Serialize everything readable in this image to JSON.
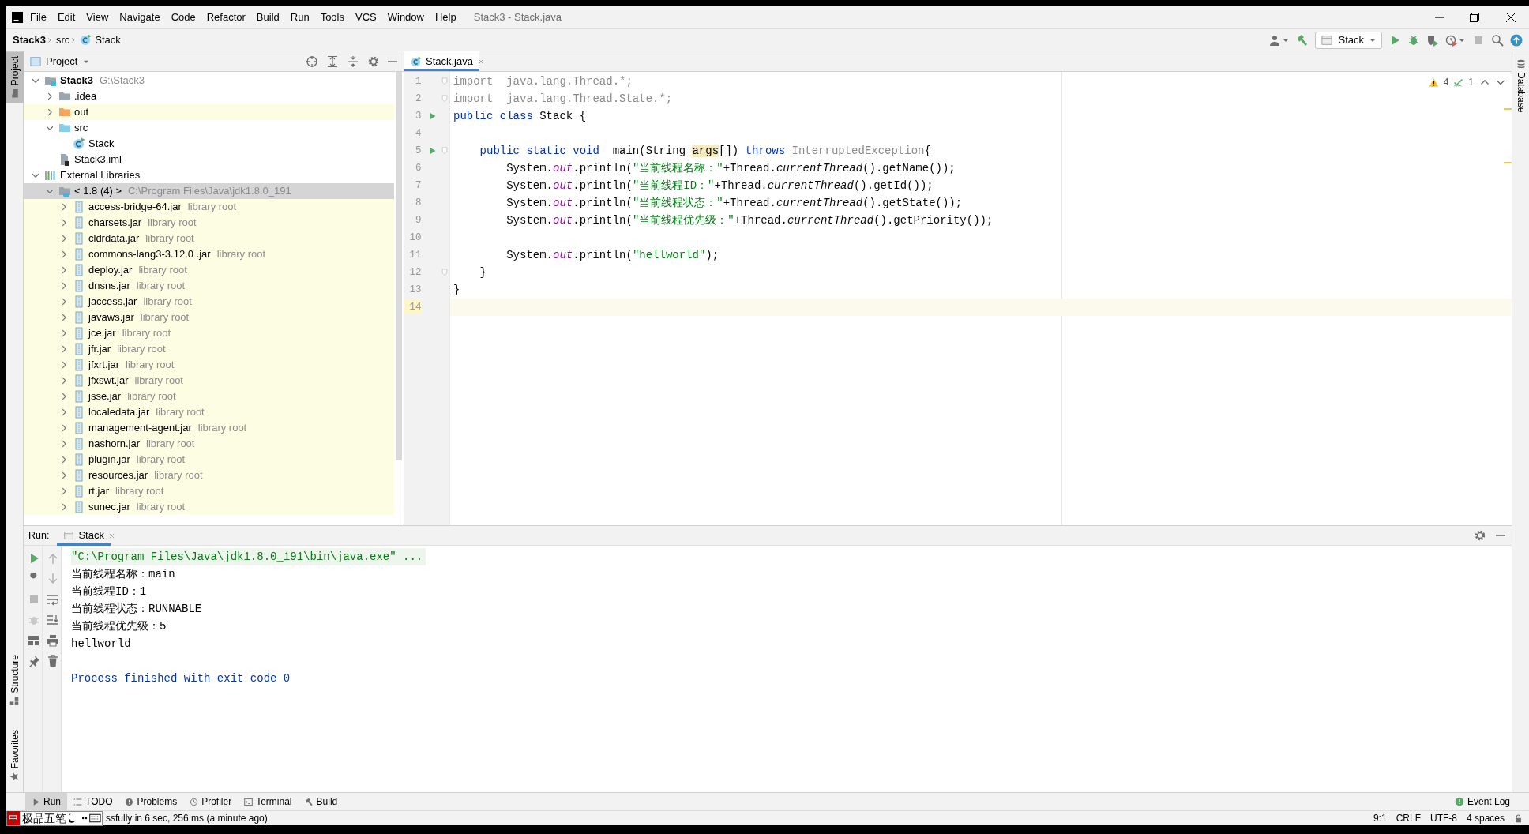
{
  "window": {
    "title": "Stack3 - Stack.java"
  },
  "menu": [
    "File",
    "Edit",
    "View",
    "Navigate",
    "Code",
    "Refactor",
    "Build",
    "Run",
    "Tools",
    "VCS",
    "Window",
    "Help"
  ],
  "breadcrumb": [
    {
      "label": "Stack3",
      "kind": "project"
    },
    {
      "label": "src",
      "kind": "folder"
    },
    {
      "label": "Stack",
      "kind": "class"
    }
  ],
  "toolbar": {
    "run_config": "Stack"
  },
  "left_stripe": {
    "top": [
      {
        "label": "Project",
        "selected": true
      }
    ],
    "bottom": [
      {
        "label": "Structure",
        "selected": false
      },
      {
        "label": "Favorites",
        "selected": false
      }
    ]
  },
  "project_panel": {
    "title": "Project",
    "tree": [
      {
        "label": "Stack3",
        "hint": "G:\\Stack3",
        "kind": "module",
        "expanded": true,
        "selected": false,
        "highlighted": false,
        "children": [
          {
            "label": ".idea",
            "kind": "folder-grey",
            "expanded": false,
            "selected": false,
            "highlighted": false
          },
          {
            "label": "out",
            "kind": "folder-orange",
            "expanded": false,
            "selected": false,
            "highlighted": true
          },
          {
            "label": "src",
            "kind": "folder-blue",
            "expanded": true,
            "selected": false,
            "highlighted": false,
            "children": [
              {
                "label": "Stack",
                "kind": "class",
                "selected": false,
                "highlighted": false
              }
            ]
          },
          {
            "label": "Stack3.iml",
            "kind": "iml",
            "selected": false,
            "highlighted": false
          }
        ]
      },
      {
        "label": "External Libraries",
        "kind": "libraries",
        "expanded": true,
        "selected": false,
        "highlighted": false,
        "children": [
          {
            "label": "< 1.8 (4) >",
            "hint": "C:\\Program Files\\Java\\jdk1.8.0_191",
            "kind": "jdk",
            "expanded": true,
            "selected": true,
            "highlighted": false,
            "children": [
              {
                "label": "access-bridge-64.jar",
                "hint": "library root",
                "kind": "jar",
                "expanded": false,
                "selected": false,
                "highlighted": true
              },
              {
                "label": "charsets.jar",
                "hint": "library root",
                "kind": "jar",
                "expanded": false,
                "selected": false,
                "highlighted": true
              },
              {
                "label": "cldrdata.jar",
                "hint": "library root",
                "kind": "jar",
                "expanded": false,
                "selected": false,
                "highlighted": true
              },
              {
                "label": "commons-lang3-3.12.0 .jar",
                "hint": "library root",
                "kind": "jar",
                "expanded": false,
                "selected": false,
                "highlighted": true
              },
              {
                "label": "deploy.jar",
                "hint": "library root",
                "kind": "jar",
                "expanded": false,
                "selected": false,
                "highlighted": true
              },
              {
                "label": "dnsns.jar",
                "hint": "library root",
                "kind": "jar",
                "expanded": false,
                "selected": false,
                "highlighted": true
              },
              {
                "label": "jaccess.jar",
                "hint": "library root",
                "kind": "jar",
                "expanded": false,
                "selected": false,
                "highlighted": true
              },
              {
                "label": "javaws.jar",
                "hint": "library root",
                "kind": "jar",
                "expanded": false,
                "selected": false,
                "highlighted": true
              },
              {
                "label": "jce.jar",
                "hint": "library root",
                "kind": "jar",
                "expanded": false,
                "selected": false,
                "highlighted": true
              },
              {
                "label": "jfr.jar",
                "hint": "library root",
                "kind": "jar",
                "expanded": false,
                "selected": false,
                "highlighted": true
              },
              {
                "label": "jfxrt.jar",
                "hint": "library root",
                "kind": "jar",
                "expanded": false,
                "selected": false,
                "highlighted": true
              },
              {
                "label": "jfxswt.jar",
                "hint": "library root",
                "kind": "jar",
                "expanded": false,
                "selected": false,
                "highlighted": true
              },
              {
                "label": "jsse.jar",
                "hint": "library root",
                "kind": "jar",
                "expanded": false,
                "selected": false,
                "highlighted": true
              },
              {
                "label": "localedata.jar",
                "hint": "library root",
                "kind": "jar",
                "expanded": false,
                "selected": false,
                "highlighted": true
              },
              {
                "label": "management-agent.jar",
                "hint": "library root",
                "kind": "jar",
                "expanded": false,
                "selected": false,
                "highlighted": true
              },
              {
                "label": "nashorn.jar",
                "hint": "library root",
                "kind": "jar",
                "expanded": false,
                "selected": false,
                "highlighted": true
              },
              {
                "label": "plugin.jar",
                "hint": "library root",
                "kind": "jar",
                "expanded": false,
                "selected": false,
                "highlighted": true
              },
              {
                "label": "resources.jar",
                "hint": "library root",
                "kind": "jar",
                "expanded": false,
                "selected": false,
                "highlighted": true
              },
              {
                "label": "rt.jar",
                "hint": "library root",
                "kind": "jar",
                "expanded": false,
                "selected": false,
                "highlighted": true
              },
              {
                "label": "sunec.jar",
                "hint": "library root",
                "kind": "jar",
                "expanded": false,
                "selected": false,
                "highlighted": true
              }
            ]
          }
        ]
      }
    ]
  },
  "editor": {
    "tabs": [
      {
        "label": "Stack.java",
        "selected": true
      }
    ],
    "inspections": {
      "warnings": "4",
      "weak_warnings": "1"
    },
    "lines": [
      {
        "number": "1",
        "run_marker": false,
        "fold_marker": true,
        "current": false,
        "tokens": [
          {
            "text": "import  java.lang.Thread.*;",
            "kind": "unused"
          }
        ]
      },
      {
        "number": "2",
        "run_marker": false,
        "fold_marker": true,
        "current": false,
        "tokens": [
          {
            "text": "import  java.lang.Thread.State.*;",
            "kind": "unused"
          }
        ]
      },
      {
        "number": "3",
        "run_marker": true,
        "fold_marker": false,
        "current": false,
        "tokens": [
          {
            "text": "public class ",
            "kind": "keyword"
          },
          {
            "text": "Stack {",
            "kind": "plain"
          }
        ]
      },
      {
        "number": "4",
        "run_marker": false,
        "fold_marker": false,
        "current": false
      },
      {
        "number": "5",
        "run_marker": true,
        "fold_marker": true,
        "current": false,
        "tokens": [
          {
            "text": "    public static void ",
            "kind": "keyword"
          },
          {
            "text": " main(String ",
            "kind": "plain"
          },
          {
            "text": "args",
            "kind": "highlight"
          },
          {
            "text": "[]) ",
            "kind": "plain"
          },
          {
            "text": "throws",
            "kind": "keyword"
          },
          {
            "text": " InterruptedException",
            "kind": "unused"
          },
          {
            "text": "{",
            "kind": "plain"
          }
        ]
      },
      {
        "number": "6",
        "run_marker": false,
        "fold_marker": false,
        "current": false,
        "tokens": [
          {
            "text": "        System.",
            "kind": "plain"
          },
          {
            "text": "out",
            "kind": "field"
          },
          {
            "text": ".println(",
            "kind": "plain"
          },
          {
            "text": "\"当前线程名称：\"",
            "kind": "string"
          },
          {
            "text": "+Thread.",
            "kind": "plain"
          },
          {
            "text": "currentThread",
            "kind": "static"
          },
          {
            "text": "().getName());",
            "kind": "plain"
          }
        ]
      },
      {
        "number": "7",
        "run_marker": false,
        "fold_marker": false,
        "current": false,
        "tokens": [
          {
            "text": "        System.",
            "kind": "plain"
          },
          {
            "text": "out",
            "kind": "field"
          },
          {
            "text": ".println(",
            "kind": "plain"
          },
          {
            "text": "\"当前线程ID：\"",
            "kind": "string"
          },
          {
            "text": "+Thread.",
            "kind": "plain"
          },
          {
            "text": "currentThread",
            "kind": "static"
          },
          {
            "text": "().getId());",
            "kind": "plain"
          }
        ]
      },
      {
        "number": "8",
        "run_marker": false,
        "fold_marker": false,
        "current": false,
        "tokens": [
          {
            "text": "        System.",
            "kind": "plain"
          },
          {
            "text": "out",
            "kind": "field"
          },
          {
            "text": ".println(",
            "kind": "plain"
          },
          {
            "text": "\"当前线程状态：\"",
            "kind": "string"
          },
          {
            "text": "+Thread.",
            "kind": "plain"
          },
          {
            "text": "currentThread",
            "kind": "static"
          },
          {
            "text": "().getState());",
            "kind": "plain"
          }
        ]
      },
      {
        "number": "9",
        "run_marker": false,
        "fold_marker": false,
        "current": false,
        "tokens": [
          {
            "text": "        System.",
            "kind": "plain"
          },
          {
            "text": "out",
            "kind": "field"
          },
          {
            "text": ".println(",
            "kind": "plain"
          },
          {
            "text": "\"当前线程优先级：\"",
            "kind": "string"
          },
          {
            "text": "+Thread.",
            "kind": "plain"
          },
          {
            "text": "currentThread",
            "kind": "static"
          },
          {
            "text": "().getPriority());",
            "kind": "plain"
          }
        ]
      },
      {
        "number": "10",
        "run_marker": false,
        "fold_marker": false,
        "current": false
      },
      {
        "number": "11",
        "run_marker": false,
        "fold_marker": false,
        "current": false,
        "tokens": [
          {
            "text": "        System.",
            "kind": "plain"
          },
          {
            "text": "out",
            "kind": "field"
          },
          {
            "text": ".println(",
            "kind": "plain"
          },
          {
            "text": "\"hellworld\"",
            "kind": "string"
          },
          {
            "text": ");",
            "kind": "plain"
          }
        ]
      },
      {
        "number": "12",
        "run_marker": false,
        "fold_marker": true,
        "current": false,
        "tokens": [
          {
            "text": "    }",
            "kind": "plain"
          }
        ]
      },
      {
        "number": "13",
        "run_marker": false,
        "fold_marker": false,
        "current": false,
        "tokens": [
          {
            "text": "}",
            "kind": "plain"
          }
        ]
      },
      {
        "number": "14",
        "run_marker": false,
        "fold_marker": false,
        "current": true
      }
    ]
  },
  "right_stripe": [
    {
      "label": "Database"
    }
  ],
  "run_panel": {
    "label": "Run:",
    "tabs": [
      {
        "label": "Stack",
        "selected": true
      }
    ],
    "console": [
      {
        "text": "\"C:\\Program Files\\Java\\jdk1.8.0_191\\bin\\java.exe\" ...",
        "kind": "command"
      },
      {
        "text": "当前线程名称：main",
        "kind": "output"
      },
      {
        "text": "当前线程ID：1",
        "kind": "output"
      },
      {
        "text": "当前线程状态：RUNNABLE",
        "kind": "output"
      },
      {
        "text": "当前线程优先级：5",
        "kind": "output"
      },
      {
        "text": "hellworld",
        "kind": "output"
      },
      {
        "text": "Process finished with exit code 0",
        "kind": "exit"
      }
    ]
  },
  "tool_windows": [
    {
      "label": "Run",
      "kind": "run",
      "selected": true
    },
    {
      "label": "TODO",
      "kind": "todo",
      "selected": false
    },
    {
      "label": "Problems",
      "kind": "problems",
      "selected": false
    },
    {
      "label": "Profiler",
      "kind": "profiler",
      "selected": false
    },
    {
      "label": "Terminal",
      "kind": "terminal",
      "selected": false
    },
    {
      "label": "Build",
      "kind": "build",
      "selected": false
    }
  ],
  "event_log": "Event Log",
  "status_bar": {
    "ime_mode": "中",
    "ime_name": "极品五笔",
    "message": "ssfully in 6 sec, 256 ms (a minute ago)",
    "position": "9:1",
    "line_separator": "CRLF",
    "encoding": "UTF-8",
    "indent": "4 spaces"
  }
}
